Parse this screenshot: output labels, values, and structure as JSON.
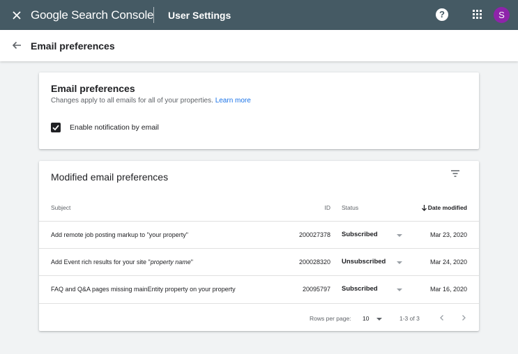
{
  "appbar": {
    "brand": "Google Search Console",
    "section": "User Settings",
    "help_glyph": "?",
    "avatar_letter": "S",
    "avatar_color": "#8e24aa",
    "bar_color": "#455a64"
  },
  "subbar": {
    "title": "Email preferences"
  },
  "preferences_card": {
    "title": "Email preferences",
    "description": "Changes apply to all emails for all of your properties.",
    "learn_more": "Learn more",
    "checkbox_label": "Enable notification by email",
    "checkbox_checked": true
  },
  "modified_card": {
    "title": "Modified email preferences",
    "columns": {
      "subject": "Subject",
      "id": "ID",
      "status": "Status",
      "date": "Date modified"
    },
    "rows": [
      {
        "subject": "Add remote job posting markup to \"your property\"",
        "id": "200027378",
        "status": "Subscribed",
        "date": "Mar 23, 2020"
      },
      {
        "subject_prefix": "Add Event rich results for your site \"",
        "subject_italic": "property name",
        "subject_suffix": "\"",
        "id": "200028320",
        "status": "Unsubscribed",
        "date": "Mar 24, 2020"
      },
      {
        "subject": "FAQ and Q&A pages missing mainEntity property on your property",
        "id": "20095797",
        "status": "Subscribed",
        "date": "Mar 16, 2020"
      }
    ],
    "footer": {
      "rows_per_page_label": "Rows per page:",
      "rows_per_page_value": "10",
      "range": "1-3 of 3"
    }
  },
  "icons": [
    "close-icon",
    "help-icon",
    "apps-icon",
    "back-arrow-icon",
    "checkbox-checked-icon",
    "filter-icon",
    "arrow-down-icon",
    "chevron-down-icon",
    "chevron-left-icon",
    "chevron-right-icon"
  ]
}
